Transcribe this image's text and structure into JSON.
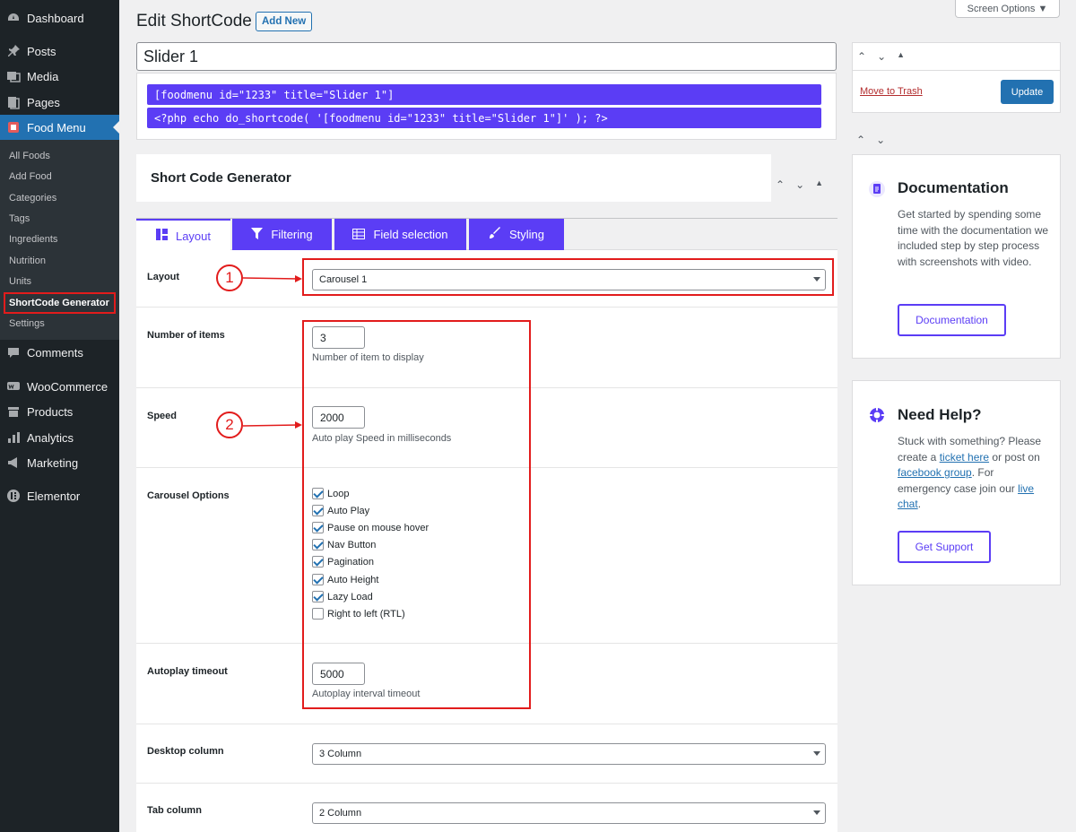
{
  "sidebar": {
    "menu": [
      {
        "label": "Dashboard",
        "icon": "dashboard-icon"
      },
      {
        "label": "Posts",
        "icon": "pin-icon"
      },
      {
        "label": "Media",
        "icon": "media-icon"
      },
      {
        "label": "Pages",
        "icon": "pages-icon"
      },
      {
        "label": "Food Menu",
        "icon": "food-menu-icon"
      },
      {
        "label": "Comments",
        "icon": "comment-icon"
      },
      {
        "label": "WooCommerce",
        "icon": "woocommerce-icon"
      },
      {
        "label": "Products",
        "icon": "products-icon"
      },
      {
        "label": "Analytics",
        "icon": "analytics-icon"
      },
      {
        "label": "Marketing",
        "icon": "megaphone-icon"
      },
      {
        "label": "Elementor",
        "icon": "elementor-icon"
      }
    ],
    "submenu": [
      "All Foods",
      "Add Food",
      "Categories",
      "Tags",
      "Ingredients",
      "Nutrition",
      "Units",
      "ShortCode Generator",
      "Settings"
    ]
  },
  "header": {
    "title": "Edit ShortCode",
    "add_new": "Add New",
    "screen_options": "Screen Options"
  },
  "post": {
    "title_value": "Slider 1",
    "shortcode": "[foodmenu id=\"1233\" title=\"Slider 1\"]",
    "php_code": "<?php echo do_shortcode( '[foodmenu id=\"1233\" title=\"Slider 1\"]' ); ?>"
  },
  "generator": {
    "title": "Short Code Generator",
    "tabs": [
      "Layout",
      "Filtering",
      "Field selection",
      "Styling"
    ],
    "fields": {
      "layout_label": "Layout",
      "layout_value": "Carousel 1",
      "items_label": "Number of items",
      "items_value": "3",
      "items_desc": "Number of item to display",
      "speed_label": "Speed",
      "speed_value": "2000",
      "speed_desc": "Auto play Speed in milliseconds",
      "carousel_label": "Carousel Options",
      "carousel_options": [
        {
          "label": "Loop",
          "checked": true
        },
        {
          "label": "Auto Play",
          "checked": true
        },
        {
          "label": "Pause on mouse hover",
          "checked": true
        },
        {
          "label": "Nav Button",
          "checked": true
        },
        {
          "label": "Pagination",
          "checked": true
        },
        {
          "label": "Auto Height",
          "checked": true
        },
        {
          "label": "Lazy Load",
          "checked": true
        },
        {
          "label": "Right to left (RTL)",
          "checked": false
        }
      ],
      "autoplay_label": "Autoplay timeout",
      "autoplay_value": "5000",
      "autoplay_desc": "Autoplay interval timeout",
      "desktop_label": "Desktop column",
      "desktop_value": "3 Column",
      "tab_label": "Tab column",
      "tab_value": "2 Column"
    }
  },
  "annotations": [
    "1",
    "2"
  ],
  "publish": {
    "trash": "Move to Trash",
    "update": "Update"
  },
  "documentation": {
    "title": "Documentation",
    "text": "Get started by spending some time with the documentation we included step by step process with screenshots with video.",
    "button": "Documentation"
  },
  "help": {
    "title": "Need Help?",
    "text_1": "Stuck with something? Please create a ",
    "link_1": "ticket here",
    "text_2": " or post on ",
    "link_2": "facebook group",
    "text_3": ". For emergency case join our ",
    "link_3": "live chat",
    "text_4": ".",
    "button": "Get Support"
  },
  "colors": {
    "accent": "#5b3df5",
    "wp_blue": "#2271b1",
    "sidebar": "#1d2327",
    "highlight": "#e21c1c"
  }
}
